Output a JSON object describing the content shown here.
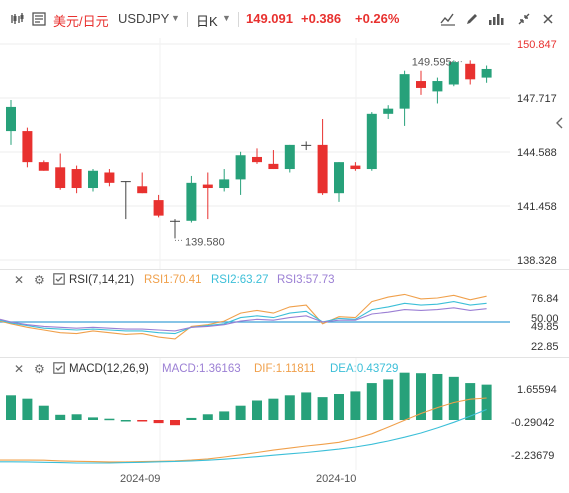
{
  "header": {
    "symbol_cn": "美元/日元",
    "symbol": "USDJPY",
    "timeframe": "日K",
    "price": "149.091",
    "change": "+0.386",
    "change_pct": "+0.26%",
    "price_color": "#e8312f"
  },
  "colors": {
    "up": "#27a17a",
    "down": "#e8312f"
  },
  "main_axis": {
    "ticks": [
      "150.847",
      "147.717",
      "144.588",
      "141.458",
      "138.328"
    ]
  },
  "rsi": {
    "name": "RSI(7,14,21)",
    "rsi1": "RSI1:70.41",
    "rsi2": "RSI2:63.27",
    "rsi3": "RSI3:57.73",
    "ticks": [
      "76.84",
      "50.00",
      "49.85",
      "22.85"
    ],
    "colors": {
      "rsi1": "#f0a04b",
      "rsi2": "#3cbfd8",
      "rsi3": "#9b7fd4",
      "mid": "#3ea0d8"
    }
  },
  "macd": {
    "name": "MACD(12,26,9)",
    "macd": "MACD:1.36163",
    "dif": "DIF:1.11811",
    "dea": "DEA:0.43729",
    "ticks": [
      "1.65594",
      "-0.29042",
      "-2.23679"
    ],
    "colors": {
      "macd": "#9b7fd4",
      "dif": "#f0a04b",
      "dea": "#3cbfd8"
    }
  },
  "x_labels": [
    "2024-09",
    "2024-10"
  ],
  "annotations": {
    "high": "149.595",
    "low": "139.580"
  },
  "chart_data": {
    "type": "candlestick",
    "y_range": [
      138.328,
      150.847
    ],
    "candles": [
      {
        "o": 145.8,
        "h": 147.6,
        "l": 145.0,
        "c": 147.2
      },
      {
        "o": 145.8,
        "h": 146.0,
        "l": 143.7,
        "c": 144.0
      },
      {
        "o": 144.0,
        "h": 144.1,
        "l": 143.5,
        "c": 143.5
      },
      {
        "o": 143.7,
        "h": 144.5,
        "l": 142.4,
        "c": 142.5
      },
      {
        "o": 143.6,
        "h": 143.8,
        "l": 142.2,
        "c": 142.5
      },
      {
        "o": 142.5,
        "h": 143.6,
        "l": 142.3,
        "c": 143.5
      },
      {
        "o": 143.4,
        "h": 143.6,
        "l": 142.6,
        "c": 142.8
      },
      {
        "o": 142.9,
        "h": 142.9,
        "l": 140.7,
        "c": 142.9
      },
      {
        "o": 142.6,
        "h": 143.4,
        "l": 142.2,
        "c": 142.2
      },
      {
        "o": 141.8,
        "h": 142.1,
        "l": 140.8,
        "c": 140.9
      },
      {
        "o": 140.6,
        "h": 140.7,
        "l": 139.58,
        "c": 140.6
      },
      {
        "o": 140.6,
        "h": 143.2,
        "l": 140.5,
        "c": 142.8
      },
      {
        "o": 142.7,
        "h": 143.4,
        "l": 140.7,
        "c": 142.5
      },
      {
        "o": 142.5,
        "h": 143.6,
        "l": 142.3,
        "c": 143.0
      },
      {
        "o": 143.0,
        "h": 144.6,
        "l": 142.1,
        "c": 144.4
      },
      {
        "o": 144.3,
        "h": 144.8,
        "l": 143.9,
        "c": 144.0
      },
      {
        "o": 143.9,
        "h": 144.7,
        "l": 143.6,
        "c": 143.6
      },
      {
        "o": 143.6,
        "h": 145.0,
        "l": 143.4,
        "c": 145.0
      },
      {
        "o": 145.0,
        "h": 145.2,
        "l": 144.7,
        "c": 145.0
      },
      {
        "o": 145.0,
        "h": 146.5,
        "l": 142.1,
        "c": 142.2
      },
      {
        "o": 142.2,
        "h": 144.0,
        "l": 141.7,
        "c": 144.0
      },
      {
        "o": 143.8,
        "h": 144.0,
        "l": 143.5,
        "c": 143.6
      },
      {
        "o": 143.6,
        "h": 146.9,
        "l": 143.5,
        "c": 146.8
      },
      {
        "o": 146.8,
        "h": 147.3,
        "l": 146.5,
        "c": 147.1
      },
      {
        "o": 147.1,
        "h": 149.3,
        "l": 146.1,
        "c": 149.1
      },
      {
        "o": 148.7,
        "h": 149.3,
        "l": 147.9,
        "c": 148.3
      },
      {
        "o": 148.1,
        "h": 148.9,
        "l": 147.4,
        "c": 148.7
      },
      {
        "o": 148.5,
        "h": 149.9,
        "l": 148.4,
        "c": 149.8
      },
      {
        "o": 149.7,
        "h": 149.9,
        "l": 148.5,
        "c": 148.8
      },
      {
        "o": 148.9,
        "h": 149.6,
        "l": 148.6,
        "c": 149.4
      }
    ],
    "rsi_range": [
      14,
      86
    ],
    "rsi1": [
      48,
      44,
      41,
      38,
      37,
      40,
      38,
      36,
      37,
      33,
      31,
      45,
      47,
      51,
      60,
      63,
      60,
      67,
      69,
      48,
      56,
      55,
      73,
      78,
      81,
      76,
      77,
      80,
      75,
      79
    ],
    "rsi2": [
      49,
      46,
      43,
      42,
      41,
      42,
      41,
      40,
      40,
      38,
      37,
      44,
      46,
      48,
      55,
      57,
      55,
      60,
      62,
      50,
      54,
      53,
      64,
      67,
      71,
      69,
      70,
      73,
      69,
      71
    ],
    "rsi3": [
      50,
      47,
      45,
      44,
      43,
      44,
      43,
      42,
      42,
      41,
      40,
      44,
      45,
      47,
      51,
      53,
      52,
      55,
      57,
      50,
      52,
      52,
      59,
      61,
      64,
      63,
      64,
      66,
      63,
      65
    ],
    "macd_range": [
      -2.9,
      2.3
    ],
    "macd_hist": [
      0.95,
      0.82,
      0.55,
      0.2,
      0.22,
      0.1,
      0.05,
      0.0,
      -0.02,
      -0.12,
      -0.2,
      0.08,
      0.22,
      0.33,
      0.55,
      0.75,
      0.82,
      0.95,
      1.06,
      0.88,
      1.0,
      1.1,
      1.42,
      1.56,
      1.82,
      1.8,
      1.77,
      1.66,
      1.42,
      1.36
    ],
    "dif": [
      -2.55,
      -2.55,
      -2.56,
      -2.6,
      -2.62,
      -2.64,
      -2.66,
      -2.66,
      -2.64,
      -2.62,
      -2.6,
      -2.55,
      -2.48,
      -2.37,
      -2.24,
      -2.1,
      -1.96,
      -1.84,
      -1.72,
      -1.62,
      -1.5,
      -1.28,
      -1.0,
      -0.6,
      -0.2,
      0.2,
      0.55,
      0.85,
      1.05,
      1.12
    ],
    "dea": [
      -2.65,
      -2.66,
      -2.68,
      -2.7,
      -2.72,
      -2.72,
      -2.72,
      -2.7,
      -2.68,
      -2.65,
      -2.63,
      -2.6,
      -2.56,
      -2.5,
      -2.43,
      -2.35,
      -2.26,
      -2.18,
      -2.1,
      -2.0,
      -1.9,
      -1.78,
      -1.62,
      -1.42,
      -1.2,
      -0.95,
      -0.65,
      -0.32,
      0.05,
      0.44
    ]
  }
}
